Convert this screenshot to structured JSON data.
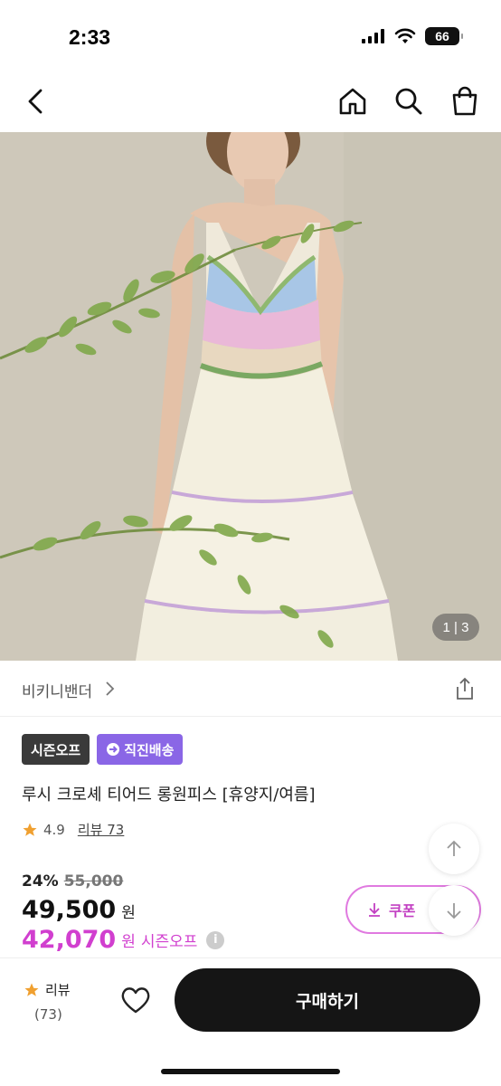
{
  "status_bar": {
    "time": "2:33",
    "battery": "66"
  },
  "nav": {
    "back_icon": "chevron-left-icon",
    "home_icon": "home-icon",
    "search_icon": "search-icon",
    "bag_icon": "shopping-bag-icon"
  },
  "gallery": {
    "counter": "1 | 3"
  },
  "seller": {
    "name": "비키니밴더",
    "chevron": ">"
  },
  "badges": [
    {
      "label": "시즌오프"
    },
    {
      "label": "직진배송"
    }
  ],
  "product": {
    "title": "루시 크로셰 티어드 롱원피스 [휴양지/여름]",
    "rating": "4.9",
    "review_link": "리뷰 73"
  },
  "price": {
    "discount_pct": "24%",
    "original": "55,000",
    "price": "49,500",
    "won": "원",
    "sale_price": "42,070",
    "sale_won": "원",
    "sale_label": "시즌오프",
    "info": "i"
  },
  "coupon": {
    "label": "쿠폰"
  },
  "bottom": {
    "review_label": "리뷰",
    "review_count": "(73)",
    "buy_label": "구매하기"
  },
  "colors": {
    "accent_pink": "#d13fcf",
    "badge_purple": "#8a66e6",
    "badge_dark": "#3a3a3a",
    "buy_button": "#151515",
    "star": "#f0a030"
  }
}
